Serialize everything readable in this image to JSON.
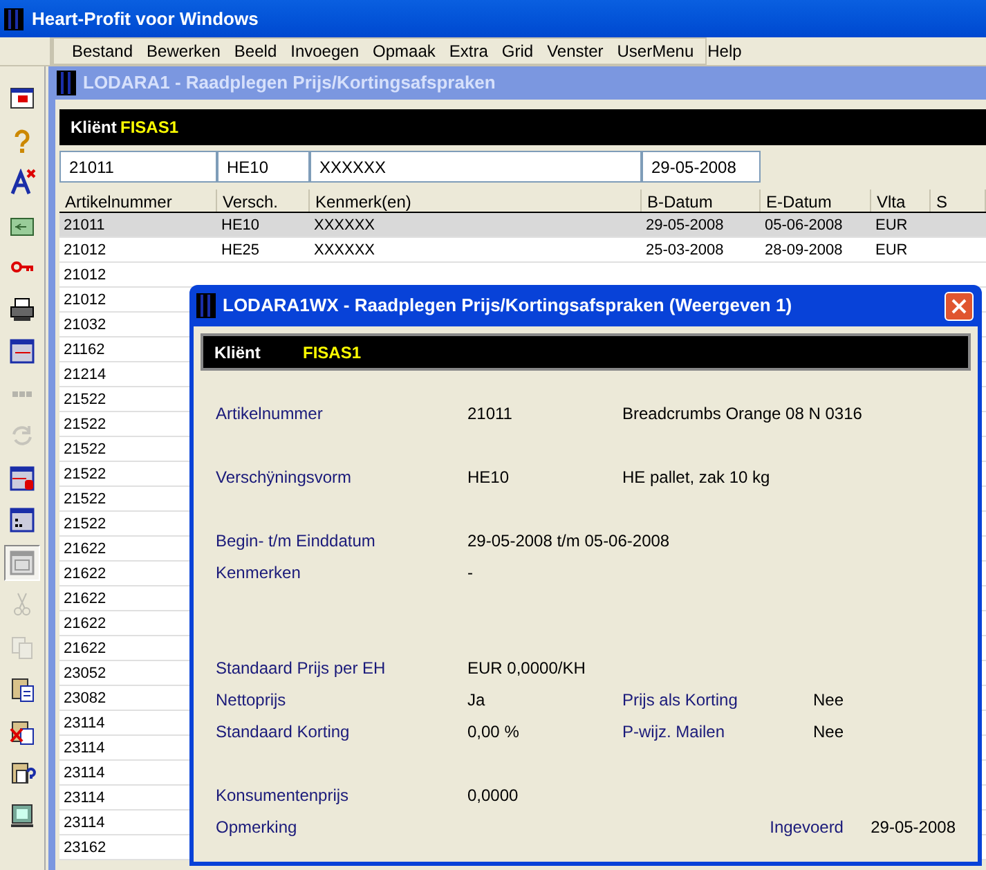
{
  "app": {
    "title": "Heart-Profit voor Windows",
    "menu": [
      "Bestand",
      "Bewerken",
      "Beeld",
      "Invoegen",
      "Opmaak",
      "Extra",
      "Grid",
      "Venster",
      "UserMenu",
      "Help"
    ]
  },
  "toolbar": [
    {
      "disabled": false,
      "pressed": false
    },
    {
      "disabled": false,
      "pressed": false
    },
    {
      "disabled": false,
      "pressed": false
    },
    {
      "disabled": false,
      "pressed": false
    },
    {
      "disabled": false,
      "pressed": false
    },
    {
      "disabled": false,
      "pressed": false
    },
    {
      "disabled": false,
      "pressed": false
    },
    {
      "disabled": true,
      "pressed": false
    },
    {
      "disabled": true,
      "pressed": false
    },
    {
      "disabled": false,
      "pressed": false
    },
    {
      "disabled": false,
      "pressed": false
    },
    {
      "disabled": false,
      "pressed": true
    },
    {
      "disabled": true,
      "pressed": false
    },
    {
      "disabled": true,
      "pressed": false
    },
    {
      "disabled": false,
      "pressed": false
    },
    {
      "disabled": false,
      "pressed": false
    },
    {
      "disabled": false,
      "pressed": false
    },
    {
      "disabled": false,
      "pressed": false
    }
  ],
  "list_window": {
    "title": "LODARA1 - Raadplegen Prijs/Kortingsafspraken",
    "client_label": "Kliënt",
    "client_value": "FISAS1",
    "filter": [
      "21011",
      "HE10",
      "XXXXXX",
      "29-05-2008"
    ],
    "columns": [
      "Artikelnummer",
      "Versch.",
      "Kenmerk(en)",
      "B-Datum",
      "E-Datum",
      "Vlta",
      "S"
    ],
    "rows": [
      {
        "selected": true,
        "cells": [
          "21011",
          "HE10",
          "XXXXXX",
          "29-05-2008",
          "05-06-2008",
          "EUR"
        ]
      },
      {
        "selected": false,
        "cells": [
          "21012",
          "HE25",
          "XXXXXX",
          "25-03-2008",
          "28-09-2008",
          "EUR"
        ]
      },
      {
        "selected": false,
        "cells": [
          "21012"
        ]
      },
      {
        "selected": false,
        "cells": [
          "21012"
        ]
      },
      {
        "selected": false,
        "cells": [
          "21032"
        ]
      },
      {
        "selected": false,
        "cells": [
          "21162"
        ]
      },
      {
        "selected": false,
        "cells": [
          "21214"
        ]
      },
      {
        "selected": false,
        "cells": [
          "21522"
        ]
      },
      {
        "selected": false,
        "cells": [
          "21522"
        ]
      },
      {
        "selected": false,
        "cells": [
          "21522"
        ]
      },
      {
        "selected": false,
        "cells": [
          "21522"
        ]
      },
      {
        "selected": false,
        "cells": [
          "21522"
        ]
      },
      {
        "selected": false,
        "cells": [
          "21522"
        ]
      },
      {
        "selected": false,
        "cells": [
          "21622"
        ]
      },
      {
        "selected": false,
        "cells": [
          "21622"
        ]
      },
      {
        "selected": false,
        "cells": [
          "21622"
        ]
      },
      {
        "selected": false,
        "cells": [
          "21622"
        ]
      },
      {
        "selected": false,
        "cells": [
          "21622"
        ]
      },
      {
        "selected": false,
        "cells": [
          "23052"
        ]
      },
      {
        "selected": false,
        "cells": [
          "23082"
        ]
      },
      {
        "selected": false,
        "cells": [
          "23114"
        ]
      },
      {
        "selected": false,
        "cells": [
          "23114"
        ]
      },
      {
        "selected": false,
        "cells": [
          "23114"
        ]
      },
      {
        "selected": false,
        "cells": [
          "23114"
        ]
      },
      {
        "selected": false,
        "cells": [
          "23114"
        ]
      },
      {
        "selected": false,
        "cells": [
          "23162"
        ]
      }
    ]
  },
  "dialog": {
    "title": "LODARA1WX - Raadplegen Prijs/Kortingsafspraken (Weergeven 1)",
    "client_label": "Kliënt",
    "client_value": "FISAS1",
    "fields": [
      {
        "label": "Artikelnummer",
        "value": "21011",
        "note": "Breadcrumbs Orange 08 N 0316"
      },
      {
        "label": "Verschÿningsvorm",
        "value": "HE10",
        "note": "HE pallet, zak 10 kg"
      },
      {
        "label": "Begin- t/m Einddatum",
        "value": "29-05-2008 t/m 05-06-2008"
      },
      {
        "label": "Kenmerken",
        "value": "-"
      },
      {
        "label": "Standaard Prijs per EH",
        "value": "EUR 0,0000/KH"
      },
      {
        "label": "Nettoprijs",
        "value": "Ja",
        "label2": "Prijs als Korting",
        "value2": "Nee"
      },
      {
        "label": "Standaard Korting",
        "value": "0,00 %",
        "label2": "P-wijz. Mailen",
        "value2": "Nee"
      },
      {
        "label": "Konsumentenprijs",
        "value": "0,0000"
      },
      {
        "label": "Opmerking",
        "entered_label": "Ingevoerd",
        "entered_value": "29-05-2008"
      }
    ]
  }
}
